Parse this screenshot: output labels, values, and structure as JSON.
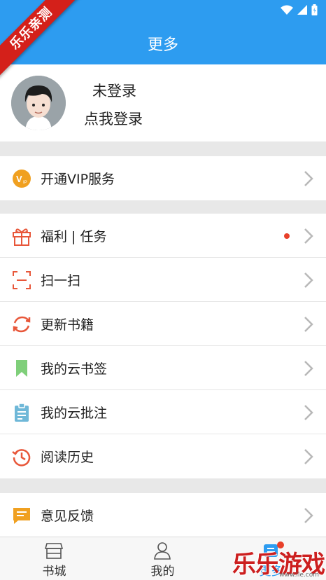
{
  "header": {
    "title": "更多"
  },
  "ribbon": {
    "text": "乐乐亲测"
  },
  "profile": {
    "status": "未登录",
    "action": "点我登录"
  },
  "menu": {
    "vip": {
      "label": "开通VIP服务"
    },
    "items": [
      {
        "label": "福利 | 任务",
        "icon": "gift-icon",
        "has_dot": true
      },
      {
        "label": "扫一扫",
        "icon": "scan-icon"
      },
      {
        "label": "更新书籍",
        "icon": "refresh-icon"
      },
      {
        "label": "我的云书签",
        "icon": "bookmark-icon"
      },
      {
        "label": "我的云批注",
        "icon": "clipboard-icon"
      },
      {
        "label": "阅读历史",
        "icon": "history-icon"
      }
    ],
    "feedback": {
      "label": "意见反馈"
    }
  },
  "tabs": [
    {
      "label": "书城",
      "icon": "store-icon"
    },
    {
      "label": "我的",
      "icon": "person-icon"
    },
    {
      "label": "更多",
      "icon": "more-icon",
      "active": true
    }
  ],
  "watermark": {
    "text": "乐乐游戏",
    "url": "www.lle.com"
  },
  "colors": {
    "primary": "#2d9cf0",
    "ribbon": "#d4201a",
    "badge": "#e8402a"
  }
}
